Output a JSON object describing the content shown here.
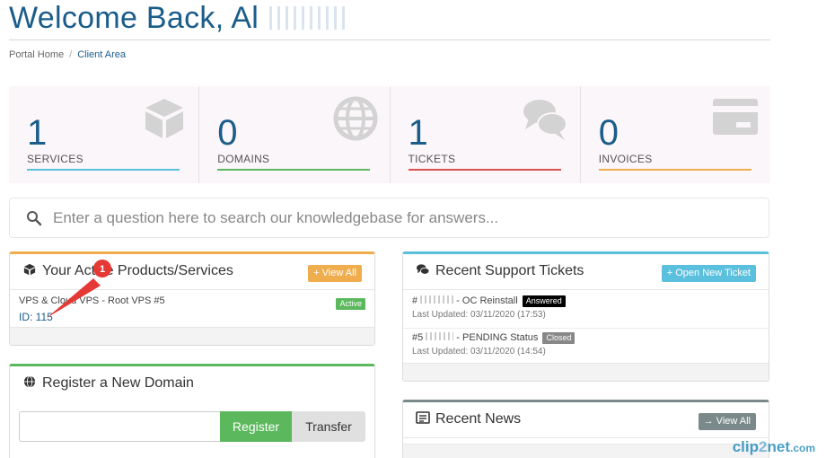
{
  "header": {
    "welcome_text": "Welcome Back, Al",
    "breadcrumb": [
      {
        "label": "Portal Home"
      },
      {
        "label": "Client Area"
      }
    ],
    "breadcrumb_sep": "/"
  },
  "stats": [
    {
      "value": "1",
      "label": "SERVICES",
      "color": "#5bc0de",
      "icon": "cube-icon"
    },
    {
      "value": "0",
      "label": "DOMAINS",
      "color": "#5cb85c",
      "icon": "globe-icon"
    },
    {
      "value": "1",
      "label": "TICKETS",
      "color": "#d9534f",
      "icon": "comments-icon"
    },
    {
      "value": "0",
      "label": "INVOICES",
      "color": "#f0ad4e",
      "icon": "credit-card-icon"
    }
  ],
  "kb_search": {
    "placeholder": "Enter a question here to search our knowledgebase for answers..."
  },
  "products_panel": {
    "title": "Your Active Products/Services",
    "button": "+ View All",
    "accent": "#f0ad4e",
    "item": {
      "name": "VPS & Cloud VPS - Root VPS #5",
      "id": "ID: 115",
      "status": "Active"
    }
  },
  "tickets_panel": {
    "title": "Recent Support Tickets",
    "button": "+ Open New Ticket",
    "accent": "#5bc0de",
    "items": [
      {
        "ref": "#",
        "subject": " - OC Reinstall",
        "status": "Answered",
        "status_color": "#000000",
        "updated": "Last Updated: 03/11/2020 (17:53)"
      },
      {
        "ref": "#5",
        "subject": " - PENDING Status",
        "status": "Closed",
        "status_color": "#888888",
        "updated": "Last Updated: 03/11/2020 (14:54)"
      }
    ]
  },
  "domain_panel": {
    "title": "Register a New Domain",
    "accent": "#5cb85c",
    "register_label": "Register",
    "transfer_label": "Transfer"
  },
  "news_panel": {
    "title": "Recent News",
    "button": "→ View All",
    "accent": "#7a8a8a"
  },
  "annotation": {
    "number": "1"
  },
  "watermark": {
    "text_a": "clip",
    "text_b": "2",
    "text_c": "net",
    "text_d": ".com"
  }
}
